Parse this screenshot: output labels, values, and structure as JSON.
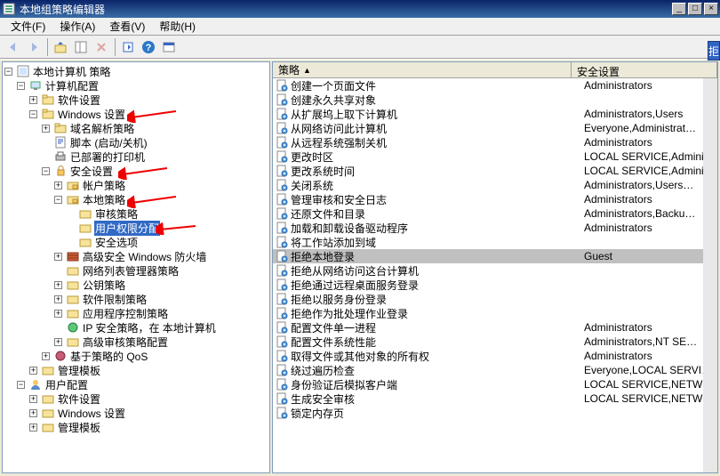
{
  "window": {
    "title": "本地组策略编辑器"
  },
  "menu": {
    "file": "文件(F)",
    "action": "操作(A)",
    "view": "查看(V)",
    "help": "帮助(H)"
  },
  "tree": {
    "root": "本地计算机 策略",
    "computer_config": "计算机配置",
    "software_settings": "软件设置",
    "windows_settings": "Windows 设置",
    "dns_policy": "域名解析策略",
    "scripts": "脚本 (启动/关机)",
    "deployed_printers": "已部署的打印机",
    "security_settings": "安全设置",
    "account_policies": "帐户策略",
    "local_policies": "本地策略",
    "audit_policy": "审核策略",
    "user_rights": "用户权限分配",
    "security_options": "安全选项",
    "adv_firewall": "高级安全 Windows 防火墙",
    "network_list": "网络列表管理器策略",
    "public_key": "公钥策略",
    "software_restriction": "软件限制策略",
    "app_control": "应用程序控制策略",
    "ip_security": "IP 安全策略，在 本地计算机",
    "adv_audit": "高级审核策略配置",
    "policy_qos": "基于策略的 QoS",
    "admin_templates": "管理模板",
    "user_config": "用户配置",
    "user_software": "软件设置",
    "user_windows": "Windows 设置",
    "user_admin_templates": "管理模板"
  },
  "columns": {
    "policy": "策略",
    "security_setting": "安全设置"
  },
  "policies": [
    {
      "name": "创建一个页面文件",
      "setting": "Administrators"
    },
    {
      "name": "创建永久共享对象",
      "setting": ""
    },
    {
      "name": "从扩展坞上取下计算机",
      "setting": "Administrators,Users"
    },
    {
      "name": "从网络访问此计算机",
      "setting": "Everyone,Administrat…"
    },
    {
      "name": "从远程系统强制关机",
      "setting": "Administrators"
    },
    {
      "name": "更改时区",
      "setting": "LOCAL SERVICE,Admini…"
    },
    {
      "name": "更改系统时间",
      "setting": "LOCAL SERVICE,Admini…"
    },
    {
      "name": "关闭系统",
      "setting": "Administrators,Users…"
    },
    {
      "name": "管理审核和安全日志",
      "setting": "Administrators"
    },
    {
      "name": "还原文件和目录",
      "setting": "Administrators,Backu…"
    },
    {
      "name": "加载和卸载设备驱动程序",
      "setting": "Administrators"
    },
    {
      "name": "将工作站添加到域",
      "setting": ""
    },
    {
      "name": "拒绝本地登录",
      "setting": "Guest",
      "selected": true
    },
    {
      "name": "拒绝从网络访问这台计算机",
      "setting": ""
    },
    {
      "name": "拒绝通过远程桌面服务登录",
      "setting": ""
    },
    {
      "name": "拒绝以服务身份登录",
      "setting": ""
    },
    {
      "name": "拒绝作为批处理作业登录",
      "setting": ""
    },
    {
      "name": "配置文件单一进程",
      "setting": "Administrators"
    },
    {
      "name": "配置文件系统性能",
      "setting": "Administrators,NT SE…"
    },
    {
      "name": "取得文件或其他对象的所有权",
      "setting": "Administrators"
    },
    {
      "name": "绕过遍历检查",
      "setting": "Everyone,LOCAL SERVI…"
    },
    {
      "name": "身份验证后模拟客户端",
      "setting": "LOCAL SERVICE,NETWOR…"
    },
    {
      "name": "生成安全审核",
      "setting": "LOCAL SERVICE,NETWOR…"
    },
    {
      "name": "锁定内存页",
      "setting": ""
    }
  ],
  "right_tab": "拒"
}
